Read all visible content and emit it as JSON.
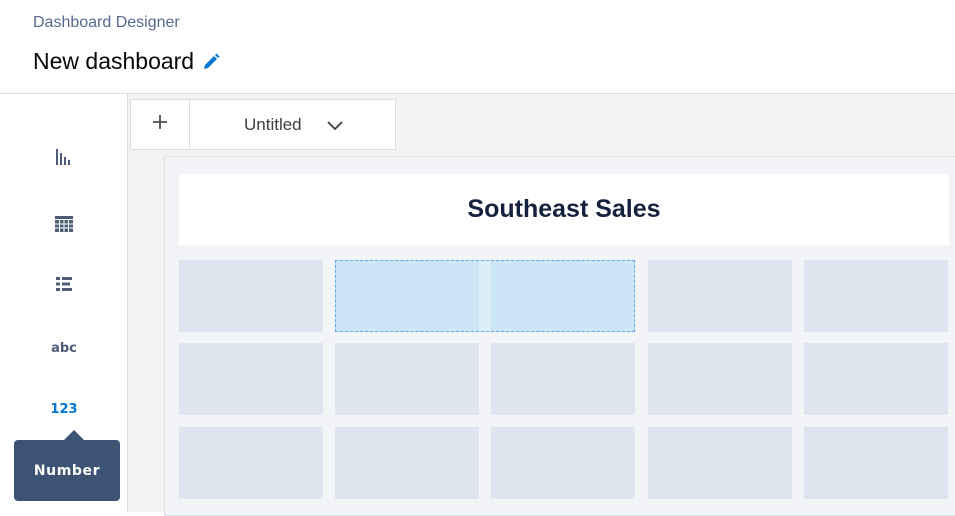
{
  "header": {
    "app_title": "Dashboard Designer",
    "dashboard_title": "New dashboard"
  },
  "toolbar": {
    "items": [
      {
        "icon": "bar-chart-icon"
      },
      {
        "icon": "table-icon"
      },
      {
        "icon": "list-icon"
      },
      {
        "label": "abc"
      },
      {
        "label": "123",
        "active": true
      }
    ],
    "tooltip": "Number"
  },
  "tabs": [
    {
      "label": "Untitled"
    }
  ],
  "dashboard": {
    "title": "Southeast Sales"
  },
  "colors": {
    "accent": "#0176d3",
    "tooltip_bg": "#3d5373",
    "drop_zone": "#cce6f5",
    "grid_cell": "#dee5ee"
  }
}
